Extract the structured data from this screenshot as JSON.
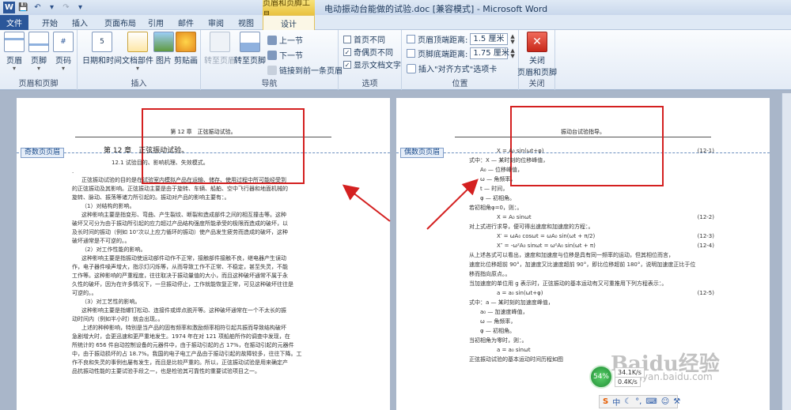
{
  "titlebar": {
    "context_tools": "页眉和页脚工具",
    "title": "电动振动台能做的试验.doc [兼容模式] - Microsoft Word"
  },
  "tabs": {
    "file": "文件",
    "home": "开始",
    "insert": "插入",
    "layout": "页面布局",
    "references": "引用",
    "mailings": "邮件",
    "review": "审阅",
    "view": "视图",
    "design": "设计"
  },
  "ribbon": {
    "hf": {
      "header": "页眉",
      "footer": "页脚",
      "page_number": "页码",
      "label": "页眉和页脚"
    },
    "insert": {
      "datetime": "日期和时间",
      "docparts": "文档部件",
      "picture": "图片",
      "clipart": "剪贴画",
      "label": "插入"
    },
    "nav": {
      "goto_header": "转至页眉",
      "goto_footer": "转至页脚",
      "prev": "上一节",
      "next": "下一节",
      "link_prev": "链接到前一条页眉",
      "label": "导航"
    },
    "options": {
      "diff_first": "首页不同",
      "diff_oddeven": "奇偶页不同",
      "show_text": "显示文档文字",
      "label": "选项"
    },
    "position": {
      "top_label": "页眉顶端距离:",
      "top_value": "1.5 厘米",
      "bottom_label": "页脚底端距离:",
      "bottom_value": "1.75 厘米",
      "align_tab": "插入\"对齐方式\"选项卡",
      "label": "位置"
    },
    "close": {
      "label1": "关闭",
      "label2": "页眉和页脚",
      "group": "关闭"
    }
  },
  "left_page": {
    "header_text": "第 12 章　正弦振动试验。",
    "header_tag": "奇数页页眉",
    "chapter": "第 12 章　正弦振动试验。",
    "section": "12.1 试验目的、影响机理、失效模式。",
    "lines": [
      "正弦振动试验的目的是在试验室内模拟产品在运输、储存、使用过程中所可能经受到",
      "的正弦振动及其影响。正弦振动主要是由于旋转、车辆、船舶、空中飞行器和地面机械的",
      "旋转、脉动、振荡等诸力所引起的。振动对产品的影响主要有：。",
      "（1）对结构的影响。",
      "这种影响主要是指变形、弯曲、产生裂纹、断裂和造成部件之间的相互撞击等。这种",
      "破坏又可分为由于振动所引起的应力超过产品结构强度所能承受的极限而造成的破坏，以",
      "及长时间的振动（例如 10⁷次以上应力循环的振动）使产品发生疲劳而造成的破坏，这种",
      "破坏通常是不可逆的。。",
      "（2）对工作性能的影响。",
      "这种影响主要是指振动使运动部件动作不正常，接触部件接触不良，继电器产生误动",
      "作，电子器件噪声增大，指示灯闪烁等，从而导致工作不正常、不稳定，甚至失灵，不能",
      "工作等。这种影响的严重程度，往往取决于振动量值的大小，而且这种破坏通常不属于永",
      "久性的破坏，因为在许多情况下，一旦振动停止，工作就能恢复正常，可见这种破坏往往是",
      "可逆的。。",
      "（3）对工艺性的影响。",
      "这种影响主要是指螺钉松动、连接件或焊点脱开等。这种破坏通常在一个不太长的振",
      "动时间内（例如半小时）就会出现。。",
      "上述的种种影响，特别是当产品的固有频率和激励频率相符引起共振而导致结构破坏",
      "急剧增大时，会更迅速和更严重地发生。1974 年在对 121 项船舶所作的调查中发现，在",
      "所统计的 656 件自动控制设备的元器件中，由于振动引起的占 17%，在振动引起的元器件",
      "中，由于振动损坏的占 18.7%。我国的电子电工产品由于振动引起的故障较多，往往下降。工",
      "作不良和失灵的事例也屡有发生，而且是比较严重的。所以，正弦振动试验是用来确定产",
      "品抗振动性能的主要试验手段之一，也是检验其可靠性的重要试验项目之一。"
    ]
  },
  "right_page": {
    "header_text": "振动台试验指导。",
    "header_tag": "偶数页页眉",
    "eqs": [
      {
        "t": "X = A₀ sin(ωt+φ)",
        "n": "(12-1)"
      },
      {
        "t": "式中：X — 某时刻的位移峰值，",
        "n": ""
      },
      {
        "t": "　　A₀ — 位移峰值，",
        "n": ""
      },
      {
        "t": "　　ω — 角频率，",
        "n": ""
      },
      {
        "t": "　　t — 时间，",
        "n": ""
      },
      {
        "t": "　　φ — 初相角。",
        "n": ""
      },
      {
        "t": "若初相角φ=0，则：。",
        "n": ""
      },
      {
        "t": "X = A₀ sinωt",
        "n": "(12-2)"
      },
      {
        "t": "对上式进行求导，便可得出速度和加速度的方程：。",
        "n": ""
      },
      {
        "t": "X′ = ωA₀ cosωt = ωA₀ sin(ωt + π/2)",
        "n": "(12-3)"
      },
      {
        "t": "X″ = -ω²A₀ sinωt = ω²A₀ sin(ωt + π)",
        "n": "(12-4)"
      },
      {
        "t": "从上述各式可以看出，速度和加速度与位移是具有同一频率的运动，但其相位而言，",
        "n": ""
      },
      {
        "t": "速度比位移超前 90°，加速度又比速度超前 90°，即比位移超前 180°，说明加速度正比于位",
        "n": ""
      },
      {
        "t": "移而指向原点。。",
        "n": ""
      },
      {
        "t": "当加速度的单位用 g 表示时，正弦振动的基本运动有又可重推用下列方程表示：。",
        "n": ""
      },
      {
        "t": "a = a₀ sin(ωt+φ)",
        "n": "(12-5)"
      },
      {
        "t": "式中：a — 某时刻的加速度峰值，",
        "n": ""
      },
      {
        "t": "　　a₀ — 加速度峰值，",
        "n": ""
      },
      {
        "t": "　　ω — 角频率，",
        "n": ""
      },
      {
        "t": "　　φ — 初相角。",
        "n": ""
      },
      {
        "t": "当初相角为零时，则：。",
        "n": ""
      },
      {
        "t": "a = a₀ sinωt",
        "n": ""
      },
      {
        "t": "正弦振动试验的基本运动时间历程如图",
        "n": ""
      }
    ]
  },
  "overlay": {
    "percent": "54%",
    "speed1": "34.1K/s",
    "speed2": "0.4K/s",
    "watermark": "Baidu经验",
    "watermark_url": "jingyan.baidu.com",
    "ime": "中"
  },
  "colors": {
    "accent": "#2b579a",
    "annotation": "#d42020"
  }
}
